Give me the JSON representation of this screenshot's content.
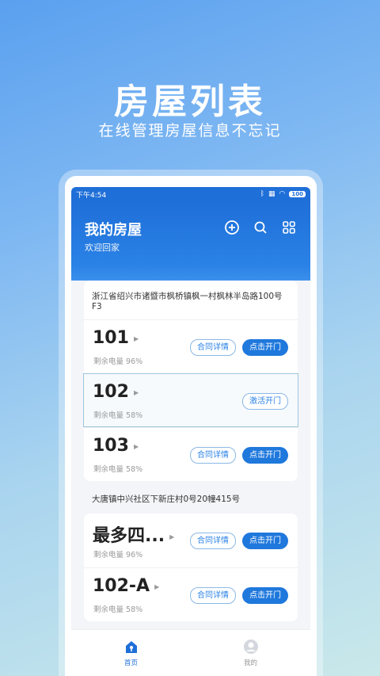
{
  "promo": {
    "title": "房屋列表",
    "subtitle": "在线管理房屋信息不忘记"
  },
  "statusbar": {
    "time": "下午4:54",
    "battery": "100"
  },
  "header": {
    "title": "我的房屋",
    "subtitle": "欢迎回家",
    "icons": [
      "add-circle-icon",
      "search-icon",
      "grid-icon"
    ]
  },
  "buildings": [
    {
      "address": "浙江省绍兴市诸暨市枫桥镇枫一村枫林半岛路100号F3",
      "rooms": [
        {
          "name": "101",
          "power": "剩余电量 96%",
          "secondary": "合同详情",
          "primary": "点击开门"
        },
        {
          "name": "102",
          "power": "剩余电量 58%",
          "secondary": "激活开门",
          "primary": ""
        },
        {
          "name": "103",
          "power": "剩余电量 58%",
          "secondary": "合同详情",
          "primary": "点击开门"
        }
      ]
    },
    {
      "address": "大唐镇中兴社区下新庄村0号20幢415号",
      "rooms": [
        {
          "name": "最多四...",
          "power": "剩余电量 96%",
          "secondary": "合同详情",
          "primary": "点击开门"
        },
        {
          "name": "102-A",
          "power": "剩余电量 58%",
          "secondary": "合同详情",
          "primary": "点击开门"
        }
      ]
    }
  ],
  "tabs": [
    {
      "label": "首页",
      "icon": "home-icon"
    },
    {
      "label": "我的",
      "icon": "profile-icon"
    }
  ],
  "colors": {
    "primary": "#1f78dc",
    "header": "#1f6fd8"
  }
}
